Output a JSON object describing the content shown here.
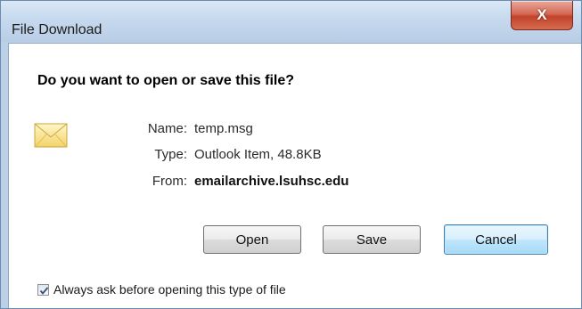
{
  "window": {
    "title": "File Download",
    "close_label": "X"
  },
  "dialog": {
    "heading": "Do you want to open or save this file?",
    "file_icon": "envelope-icon",
    "name_label": "Name:",
    "name_value": "temp.msg",
    "type_label": "Type:",
    "type_value": "Outlook Item, 48.8KB",
    "from_label": "From:",
    "from_value": "emailarchive.lsuhsc.edu"
  },
  "buttons": {
    "open_label": "Open",
    "save_label": "Save",
    "cancel_label": "Cancel"
  },
  "checkbox": {
    "label": "Always ask before opening this type of file",
    "checked": true
  },
  "colors": {
    "title_bar": "#c6d9ee",
    "close_button": "#c2432b",
    "default_button": "#bee6fd"
  }
}
